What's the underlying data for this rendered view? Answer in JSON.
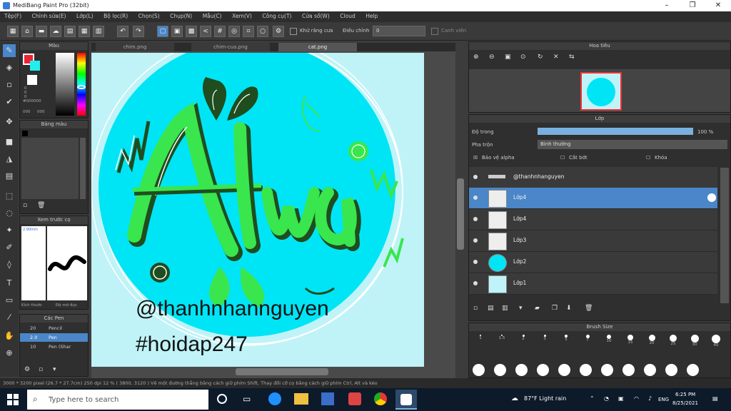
{
  "window": {
    "title": "MediBang Paint Pro (32bit)",
    "minimize": "–",
    "maximize": "❐",
    "close": "✕"
  },
  "menu": [
    "Tệp(F)",
    "Chỉnh sửa(E)",
    "Lớp(L)",
    "Bộ lọc(R)",
    "Chọn(S)",
    "Chụp(N)",
    "Mẫu(C)",
    "Xem(V)",
    "Công cụ(T)",
    "Cửa sổ(W)",
    "Cloud",
    "Help"
  ],
  "toolbar": {
    "anti_alias_label": "Khử răng cưa",
    "correction_label": "Điều chỉnh",
    "correction_value": "0",
    "canvas_label": "Canh viền"
  },
  "panels": {
    "color": "Màu",
    "color_values": [
      "0",
      "0",
      "0",
      "#000000"
    ],
    "color_codes": [
      "000",
      "000"
    ],
    "palette": "Bảng màu",
    "brush_preview": "Xem trước cọ",
    "brush_preview_size": "2.90mm",
    "brush_tabs": [
      "Kích thước",
      "Độ mờ đục"
    ],
    "brushes_header": "Các Pen",
    "brushes": [
      {
        "size": "20",
        "name": "Pencil"
      },
      {
        "size": "2.0",
        "name": "Pen"
      },
      {
        "size": "10",
        "name": "Pen (Shar"
      }
    ],
    "navigator": "Hoa tiêu",
    "layers": "Lớp",
    "brush_size": "Brush Size"
  },
  "layers_panel": {
    "opacity_label": "Độ trong",
    "opacity_value": "100 %",
    "opacity_fraction": 1.0,
    "blend_label": "Pha trộn",
    "blend_value": "Bình thường",
    "protect_alpha": "Bảo vệ alpha",
    "clipping": "Cắt bớt",
    "lock": "Khóa",
    "rows": [
      {
        "name": "@thanhnhanguyen",
        "selected": false
      },
      {
        "name": "Lớp4",
        "selected": true
      },
      {
        "name": "Lớp4",
        "selected": false
      },
      {
        "name": "Lớp3",
        "selected": false
      },
      {
        "name": "Lớp2",
        "selected": false
      },
      {
        "name": "Lớp1",
        "selected": false
      }
    ]
  },
  "brush_sizes_row1": [
    "1",
    "1.5",
    "2",
    "3",
    "5",
    "7",
    "10",
    "15",
    "20",
    "25",
    "30",
    "40"
  ],
  "tabs": [
    "chim.png",
    "chim-cua.png",
    "cat.png"
  ],
  "canvas": {
    "title_text": "Alva",
    "handle": "@thanhnhannguyen",
    "hashtag": "#hoidap247"
  },
  "status": "3000 * 3200 pixel  (26.7 * 27.7cm)  250 dpi  12 %  ( 3800, 3120 )  Vẽ một đường thẳng bằng cách giữ phím Shift, Thay đổi cỡ cọ bằng cách giữ phím Ctrl, Alt và kéo",
  "taskbar": {
    "search_placeholder": "Type here to search",
    "weather": "87°F  Light rain",
    "lang": "ENG",
    "time": "6:25 PM",
    "date": "8/25/2021"
  },
  "colors": {
    "accent": "#4a86c8",
    "canvas_bg": "#bff3f7",
    "circle": "#00e5f5",
    "green": "#39e64d",
    "dark_green": "#1f4d1f"
  }
}
